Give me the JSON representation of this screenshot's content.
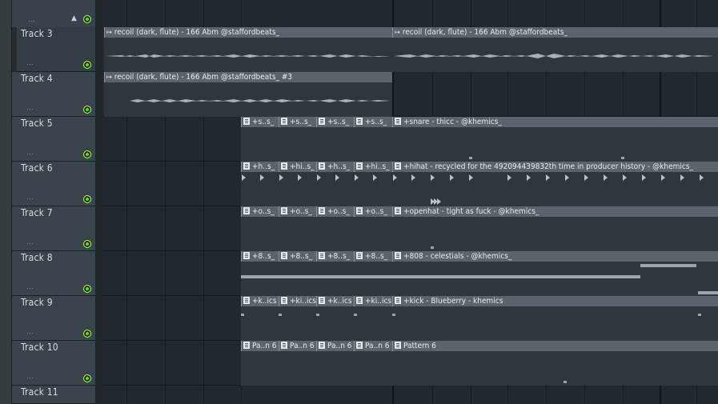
{
  "tracks": [
    {
      "name": "Track 3",
      "dots": "..."
    },
    {
      "name": "Track 4",
      "dots": "..."
    },
    {
      "name": "Track 5",
      "dots": "..."
    },
    {
      "name": "Track 6",
      "dots": "..."
    },
    {
      "name": "Track 7",
      "dots": "..."
    },
    {
      "name": "Track 8",
      "dots": "..."
    },
    {
      "name": "Track 9",
      "dots": "..."
    },
    {
      "name": "Track 10",
      "dots": "..."
    },
    {
      "name": "Track 11",
      "dots": "..."
    }
  ],
  "header": {
    "dots": "...",
    "scroll_icon": "▲"
  },
  "clips": {
    "t3a": "recoil (dark, flute) - 166 Abm @staffordbeats_",
    "t3b": "recoil (dark, flute) - 166 Abm @staffordbeats_",
    "t4a": "recoil (dark, flute) - 166 Abm @staffordbeats_ #3",
    "t5s": "+s..s_",
    "t5": "+snare - thicc - @khemics_",
    "t6s1": "+h..s_",
    "t6s2": "+hi..s_",
    "t6s3": "+h..s_",
    "t6s4": "+hi..s_",
    "t6": "+hihat - recycled for the 492094439832th time in producer history - @khemics_",
    "t7s": "+o..s_",
    "t7": "+openhat - tight as fuck - @khemics_",
    "t8s": "+8..s_",
    "t8": "+808 - celestials - @khemics_",
    "t9s1": "+k..ics",
    "t9s2": "+ki..ics",
    "t9s3": "+k..ics",
    "t9s4": "+ki..ics",
    "t9": "+kick - Blueberry - khemics",
    "t10s": "Pa..n 6",
    "t10": "Pattern 6"
  },
  "icons": {
    "audio_clip": "audio-clip-icon",
    "pattern_clip": "pattern-clip-icon",
    "led": "led-icon"
  }
}
